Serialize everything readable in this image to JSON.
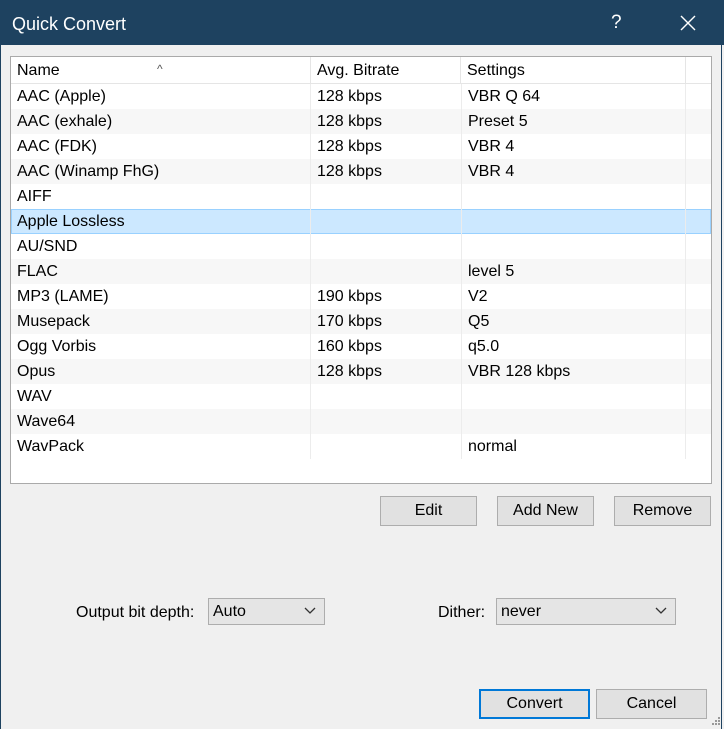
{
  "window": {
    "title": "Quick Convert",
    "help_glyph": "?"
  },
  "list": {
    "columns": [
      "Name",
      "Avg. Bitrate",
      "Settings"
    ],
    "rows": [
      {
        "name": "AAC (Apple)",
        "bitrate": "128 kbps",
        "settings": "VBR Q 64"
      },
      {
        "name": "AAC (exhale)",
        "bitrate": "128 kbps",
        "settings": "Preset 5"
      },
      {
        "name": "AAC (FDK)",
        "bitrate": "128 kbps",
        "settings": "VBR 4"
      },
      {
        "name": "AAC (Winamp FhG)",
        "bitrate": "128 kbps",
        "settings": "VBR 4"
      },
      {
        "name": "AIFF",
        "bitrate": "",
        "settings": ""
      },
      {
        "name": "Apple Lossless",
        "bitrate": "",
        "settings": "",
        "selected": true
      },
      {
        "name": "AU/SND",
        "bitrate": "",
        "settings": ""
      },
      {
        "name": "FLAC",
        "bitrate": "",
        "settings": "level 5"
      },
      {
        "name": "MP3 (LAME)",
        "bitrate": "190 kbps",
        "settings": "V2"
      },
      {
        "name": "Musepack",
        "bitrate": "170 kbps",
        "settings": "Q5"
      },
      {
        "name": "Ogg Vorbis",
        "bitrate": "160 kbps",
        "settings": "q5.0"
      },
      {
        "name": "Opus",
        "bitrate": "128 kbps",
        "settings": "VBR 128 kbps"
      },
      {
        "name": "WAV",
        "bitrate": "",
        "settings": ""
      },
      {
        "name": "Wave64",
        "bitrate": "",
        "settings": ""
      },
      {
        "name": "WavPack",
        "bitrate": "",
        "settings": "normal"
      }
    ]
  },
  "buttons": {
    "edit": "Edit",
    "add_new": "Add New",
    "remove": "Remove",
    "convert": "Convert",
    "cancel": "Cancel"
  },
  "output_bit_depth": {
    "label": "Output bit depth:",
    "value": "Auto"
  },
  "dither": {
    "label": "Dither:",
    "value": "never"
  },
  "colors": {
    "titlebar": "#1e4260",
    "selection": "#cce8ff",
    "default_button_border": "#0078d7"
  }
}
